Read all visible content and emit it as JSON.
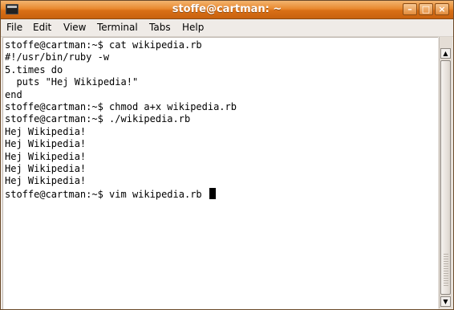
{
  "window": {
    "title": "stoffe@cartman: ~",
    "controls": {
      "minimize": "–",
      "maximize": "□",
      "close": "×"
    }
  },
  "menu": {
    "items": [
      {
        "id": "file",
        "label": "File"
      },
      {
        "id": "edit",
        "label": "Edit"
      },
      {
        "id": "view",
        "label": "View"
      },
      {
        "id": "terminal",
        "label": "Terminal"
      },
      {
        "id": "tabs",
        "label": "Tabs"
      },
      {
        "id": "help",
        "label": "Help"
      }
    ]
  },
  "terminal": {
    "lines": [
      "stoffe@cartman:~$ cat wikipedia.rb",
      "#!/usr/bin/ruby -w",
      "",
      "5.times do",
      "  puts \"Hej Wikipedia!\"",
      "end",
      "",
      "stoffe@cartman:~$ chmod a+x wikipedia.rb",
      "stoffe@cartman:~$ ./wikipedia.rb",
      "Hej Wikipedia!",
      "Hej Wikipedia!",
      "Hej Wikipedia!",
      "Hej Wikipedia!",
      "Hej Wikipedia!",
      "stoffe@cartman:~$ vim wikipedia.rb "
    ]
  },
  "icons": {
    "window_icon": "terminal-icon",
    "scroll_up": "arrow-up-icon",
    "scroll_down": "arrow-down-icon"
  },
  "colors": {
    "titlebar": "#e9892f",
    "terminal_bg": "#ffffff",
    "terminal_fg": "#000000"
  }
}
